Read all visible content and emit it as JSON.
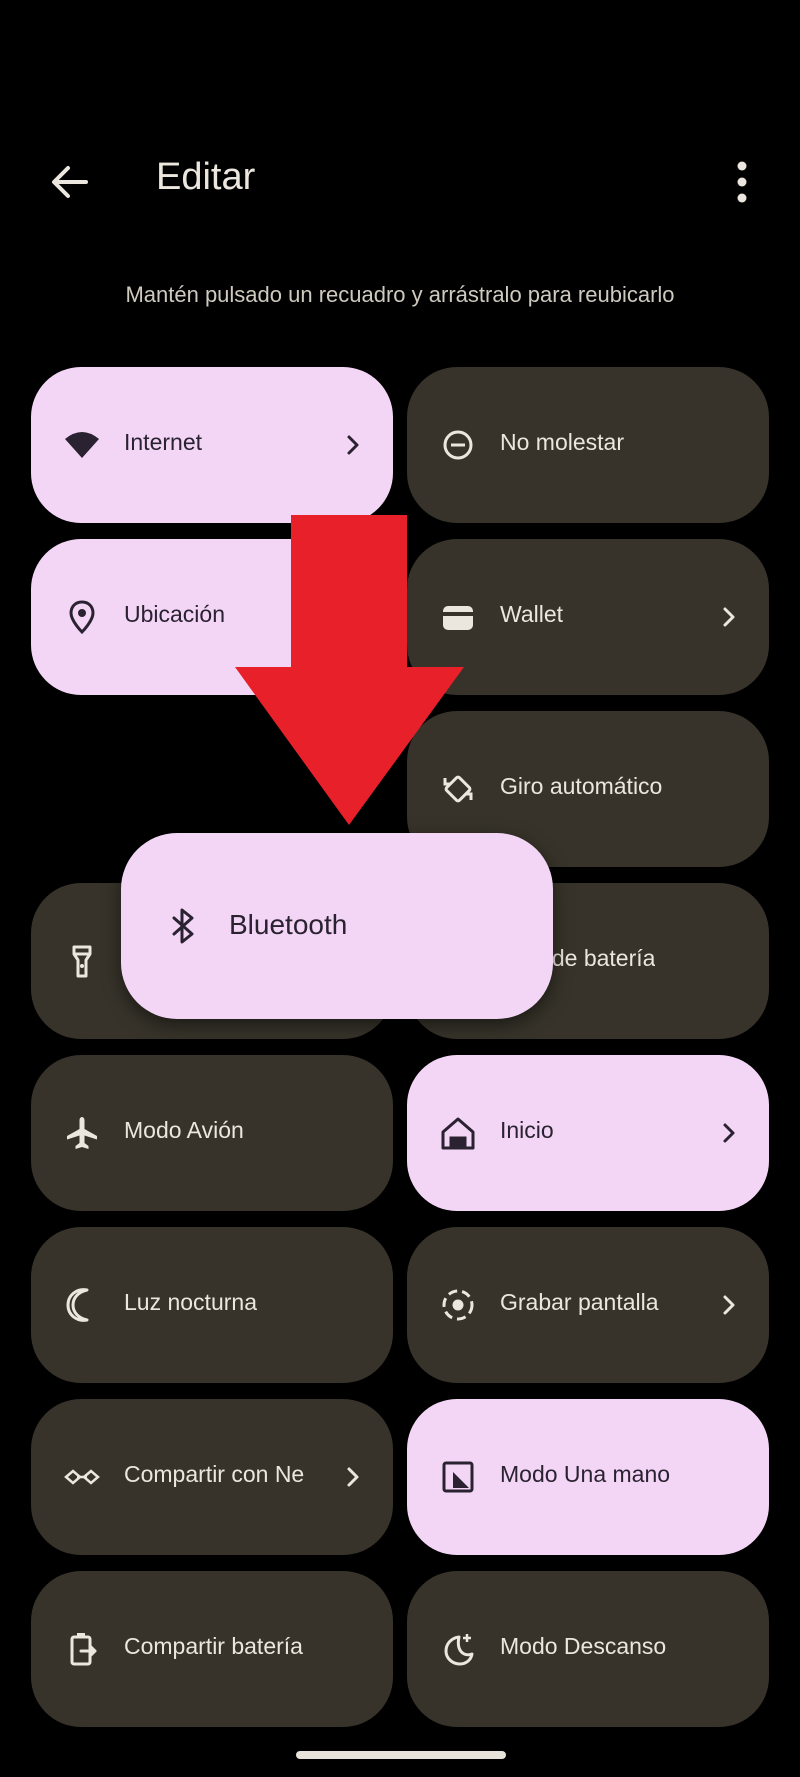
{
  "header": {
    "title": "Editar",
    "back_icon": "arrow-left-icon",
    "more_icon": "more-vert-icon"
  },
  "hint": "Mantén pulsado un recuadro y arrástralo para reubicarlo",
  "colors": {
    "background": "#000000",
    "tile_off": "#37332a",
    "tile_on": "#f3d6f6",
    "arrow": "#e8202a"
  },
  "tiles": [
    {
      "label": "Internet",
      "icon": "wifi-icon",
      "active": true,
      "chevron": true
    },
    {
      "label": "No molestar",
      "icon": "do-not-disturb-icon",
      "active": false,
      "chevron": false
    },
    {
      "label": "Ubicación",
      "icon": "location-pin-icon",
      "active": true,
      "chevron": false
    },
    {
      "label": "Wallet",
      "icon": "wallet-icon",
      "active": false,
      "chevron": true
    },
    {
      "label": "Giro automático",
      "icon": "auto-rotate-icon",
      "active": false,
      "chevron": false
    },
    {
      "label": "ro de batería",
      "icon": "flashlight-icon",
      "active": false,
      "chevron": false
    },
    {
      "label": "Modo Avión",
      "icon": "airplane-icon",
      "active": false,
      "chevron": false
    },
    {
      "label": "Inicio",
      "icon": "home-icon",
      "active": true,
      "chevron": true
    },
    {
      "label": "Luz nocturna",
      "icon": "night-light-icon",
      "active": false,
      "chevron": false
    },
    {
      "label": "Grabar pantalla",
      "icon": "screen-record-icon",
      "active": false,
      "chevron": true
    },
    {
      "label": "Compartir con Ne",
      "icon": "nearby-share-icon",
      "active": false,
      "chevron": true
    },
    {
      "label": "Modo Una mano",
      "icon": "one-hand-icon",
      "active": true,
      "chevron": false
    },
    {
      "label": "Compartir batería",
      "icon": "battery-share-icon",
      "active": false,
      "chevron": false
    },
    {
      "label": "Modo Descanso",
      "icon": "bedtime-icon",
      "active": false,
      "chevron": false
    }
  ],
  "dragged_tile": {
    "label": "Bluetooth",
    "icon": "bluetooth-icon"
  }
}
